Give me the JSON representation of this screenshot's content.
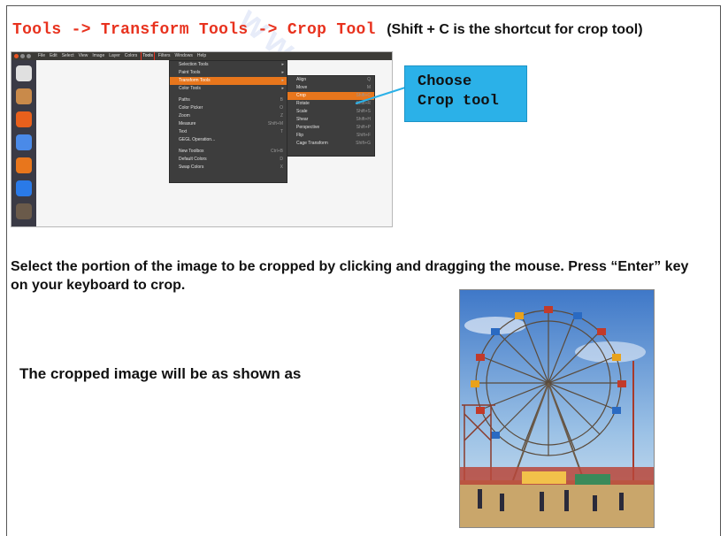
{
  "header": {
    "breadcrumb": "Tools -> Transform Tools -> Crop Tool",
    "shortcut_note": "(Shift + C is the shortcut for crop tool)"
  },
  "watermark": "www.c",
  "gimp": {
    "menubar": [
      "File",
      "Edit",
      "Select",
      "View",
      "Image",
      "Layer",
      "Colors",
      "Tools",
      "Filters",
      "Windows",
      "Help"
    ],
    "active_menu": "Tools",
    "tools_menu": [
      {
        "label": "Selection Tools",
        "submenu": true
      },
      {
        "label": "Paint Tools",
        "submenu": true
      },
      {
        "label": "Transform Tools",
        "submenu": true,
        "highlighted": true
      },
      {
        "label": "Color Tools",
        "submenu": true
      },
      {
        "label": "Paths",
        "shortcut": "B"
      },
      {
        "label": "Color Picker",
        "shortcut": "O"
      },
      {
        "label": "Zoom",
        "shortcut": "Z"
      },
      {
        "label": "Measure",
        "shortcut": "Shift+M"
      },
      {
        "label": "Text",
        "shortcut": "T"
      },
      {
        "label": "GEGL Operation...",
        "shortcut": ""
      },
      {
        "label": "New Toolbox",
        "shortcut": "Ctrl+B"
      },
      {
        "label": "Default Colors",
        "shortcut": "D"
      },
      {
        "label": "Swap Colors",
        "shortcut": "X"
      }
    ],
    "transform_menu": [
      {
        "label": "Align",
        "shortcut": "Q"
      },
      {
        "label": "Move",
        "shortcut": "M"
      },
      {
        "label": "Crop",
        "shortcut": "Shift+C",
        "highlighted": true
      },
      {
        "label": "Rotate",
        "shortcut": "Shift+R"
      },
      {
        "label": "Scale",
        "shortcut": "Shift+S"
      },
      {
        "label": "Shear",
        "shortcut": "Shift+H"
      },
      {
        "label": "Perspective",
        "shortcut": "Shift+P"
      },
      {
        "label": "Flip",
        "shortcut": "Shift+F"
      },
      {
        "label": "Cage Transform",
        "shortcut": "Shift+G"
      }
    ],
    "launcher_icons": [
      "dash-icon",
      "files-icon",
      "firefox-icon",
      "chromium-icon",
      "software-center-icon",
      "teamviewer-icon",
      "gimp-icon"
    ]
  },
  "callout": {
    "line1": "Choose",
    "line2": "Crop tool",
    "color": "#2bb1e8"
  },
  "instruction": "Select the portion of the image to be cropped by clicking and dragging the mouse. Press “Enter” key on your keyboard to crop.",
  "result_label": "The cropped image will be as shown as",
  "photo_subject": "ferris-wheel-photo"
}
